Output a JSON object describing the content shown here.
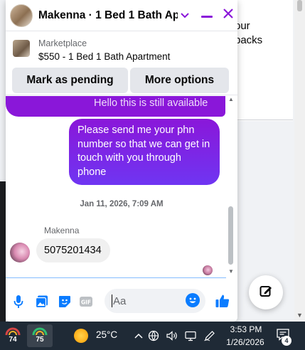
{
  "background": {
    "snippets": [
      "our",
      "backs"
    ]
  },
  "chat": {
    "title": "Makenna · 1 Bed 1 Bath Ap...",
    "listing": {
      "source": "Marketplace",
      "title": "$550 - 1 Bed 1 Bath Apartment"
    },
    "buttons": {
      "pending": "Mark as pending",
      "more": "More options"
    },
    "messages": {
      "partial_sent": "Hello this is still available",
      "sent": "Please send me your phn number so that we can get in touch with you through phone",
      "timestamp": "Jan 11, 2026, 7:09 AM",
      "sender_name": "Makenna",
      "received": "5075201434"
    },
    "composer": {
      "placeholder": "Aa"
    },
    "colors": {
      "accent": "#8a17d9",
      "brand_blue": "#0a7cff"
    }
  },
  "taskbar": {
    "apps": [
      {
        "icon": "weather-app-icon",
        "label": "74"
      },
      {
        "icon": "weather-app-icon",
        "label": "75"
      }
    ],
    "temperature": "25°C",
    "time": "3:53 PM",
    "date": "1/26/2026",
    "notification_count": "4"
  }
}
